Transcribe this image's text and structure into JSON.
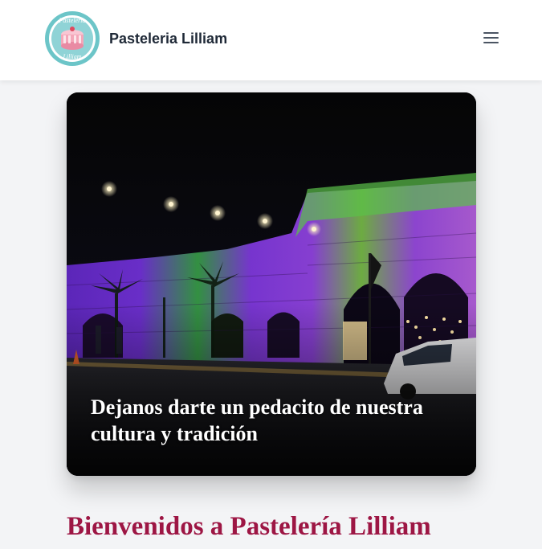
{
  "header": {
    "logo": {
      "text_top": "Pastelería",
      "text_bottom": "Lilliam"
    },
    "brand_name": "Pasteleria Lilliam",
    "menu_icon": "hamburger-menu-icon"
  },
  "hero": {
    "caption": "Dejanos darte un pedacito de nuestra cultura y tradición"
  },
  "main": {
    "welcome_title": "Bienvenidos a Pastelería Lilliam"
  },
  "colors": {
    "header_bg": "#ffffff",
    "page_bg": "#f3f4f6",
    "brand_text": "#1f2937",
    "welcome_accent": "#9d1644",
    "logo_teal": "#6cc5c8",
    "logo_pink": "#f4a7b9"
  }
}
